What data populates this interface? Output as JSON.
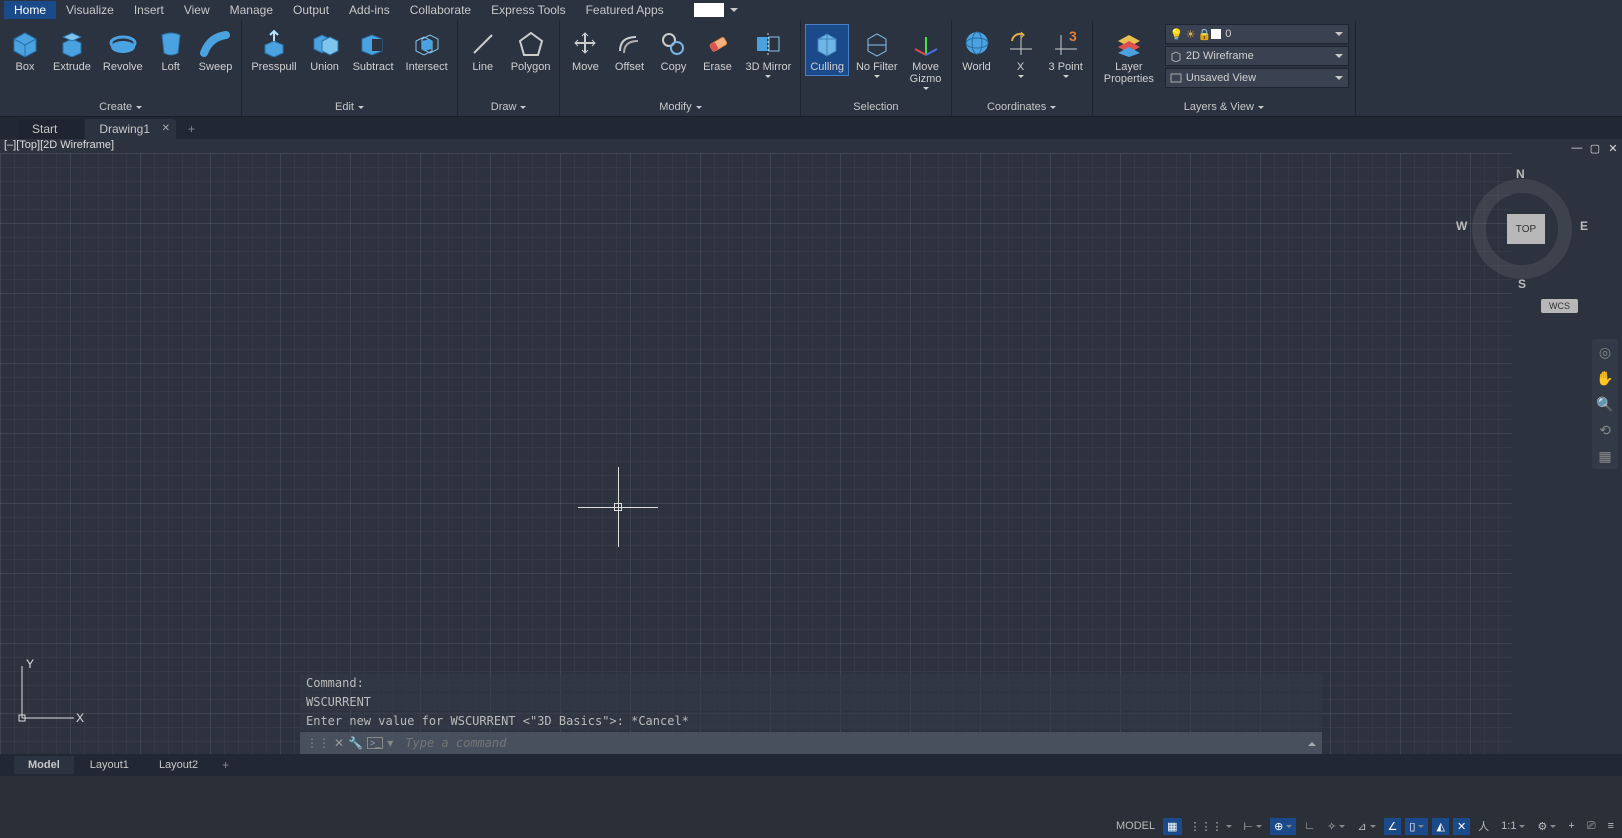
{
  "menu": {
    "items": [
      "Home",
      "Visualize",
      "Insert",
      "View",
      "Manage",
      "Output",
      "Add-ins",
      "Collaborate",
      "Express Tools",
      "Featured Apps"
    ],
    "active": 0
  },
  "ribbon": {
    "panels": [
      {
        "caption": "Create",
        "tools": [
          {
            "name": "box",
            "label": "Box"
          },
          {
            "name": "extrude",
            "label": "Extrude"
          },
          {
            "name": "revolve",
            "label": "Revolve"
          },
          {
            "name": "loft",
            "label": "Loft"
          },
          {
            "name": "sweep",
            "label": "Sweep"
          }
        ]
      },
      {
        "caption": "Edit",
        "tools": [
          {
            "name": "presspull",
            "label": "Presspull"
          },
          {
            "name": "union",
            "label": "Union"
          },
          {
            "name": "subtract",
            "label": "Subtract"
          },
          {
            "name": "intersect",
            "label": "Intersect"
          }
        ]
      },
      {
        "caption": "Draw",
        "tools": [
          {
            "name": "line",
            "label": "Line"
          },
          {
            "name": "polygon",
            "label": "Polygon"
          }
        ]
      },
      {
        "caption": "Modify",
        "tools": [
          {
            "name": "move",
            "label": "Move"
          },
          {
            "name": "offset",
            "label": "Offset"
          },
          {
            "name": "copy",
            "label": "Copy"
          },
          {
            "name": "erase",
            "label": "Erase"
          },
          {
            "name": "mirror3d",
            "label": "3D Mirror"
          }
        ]
      },
      {
        "caption": "Selection",
        "tools": [
          {
            "name": "culling",
            "label": "Culling",
            "active": true
          },
          {
            "name": "nofilter",
            "label": "No Filter"
          },
          {
            "name": "movegizmo",
            "label": "Move\nGizmo"
          }
        ]
      },
      {
        "caption": "Coordinates",
        "tools": [
          {
            "name": "world",
            "label": "World"
          },
          {
            "name": "x",
            "label": "X"
          },
          {
            "name": "3point",
            "label": "3 Point"
          }
        ]
      },
      {
        "caption": "Layers & View",
        "tools": [
          {
            "name": "layerprops",
            "label": "Layer\nProperties"
          }
        ]
      }
    ],
    "layer_dd1_value": "0",
    "layer_dd2_value": "2D Wireframe",
    "layer_dd3_value": "Unsaved View"
  },
  "doctabs": {
    "start": "Start",
    "drawing": "Drawing1"
  },
  "viewport": {
    "header": "[–][Top][2D Wireframe]",
    "viewcube": {
      "top": "TOP",
      "n": "N",
      "s": "S",
      "e": "E",
      "w": "W"
    },
    "wcs": "WCS",
    "ucs": {
      "x": "X",
      "y": "Y"
    }
  },
  "cmd": {
    "hist1": "Command:",
    "hist2": "WSCURRENT",
    "hist3": "Enter new value for WSCURRENT <\"3D Basics\">: *Cancel*",
    "placeholder": "Type a command"
  },
  "bottomtabs": {
    "model": "Model",
    "l1": "Layout1",
    "l2": "Layout2"
  },
  "statusbar": {
    "model": "MODEL",
    "scale": "1:1"
  }
}
